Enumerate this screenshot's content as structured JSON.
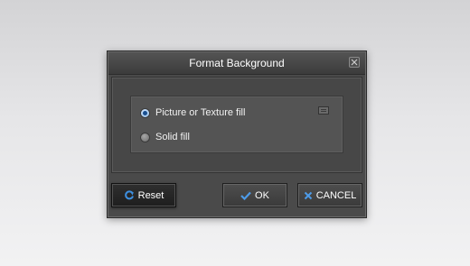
{
  "dialog": {
    "title": "Format Background",
    "close_icon": "close-icon",
    "options": [
      {
        "label": "Picture or Texture fill",
        "selected": true
      },
      {
        "label": "Solid fill",
        "selected": false
      }
    ],
    "menu_icon": "hamburger-icon",
    "buttons": {
      "reset": {
        "label": "Reset",
        "icon": "refresh-icon",
        "icon_color": "#3d8fe0"
      },
      "ok": {
        "label": "OK",
        "icon": "checkmark-icon",
        "icon_color": "#4d9be8"
      },
      "cancel": {
        "label": "CANCEL",
        "icon": "x-icon",
        "icon_color": "#4d9be8"
      }
    }
  }
}
